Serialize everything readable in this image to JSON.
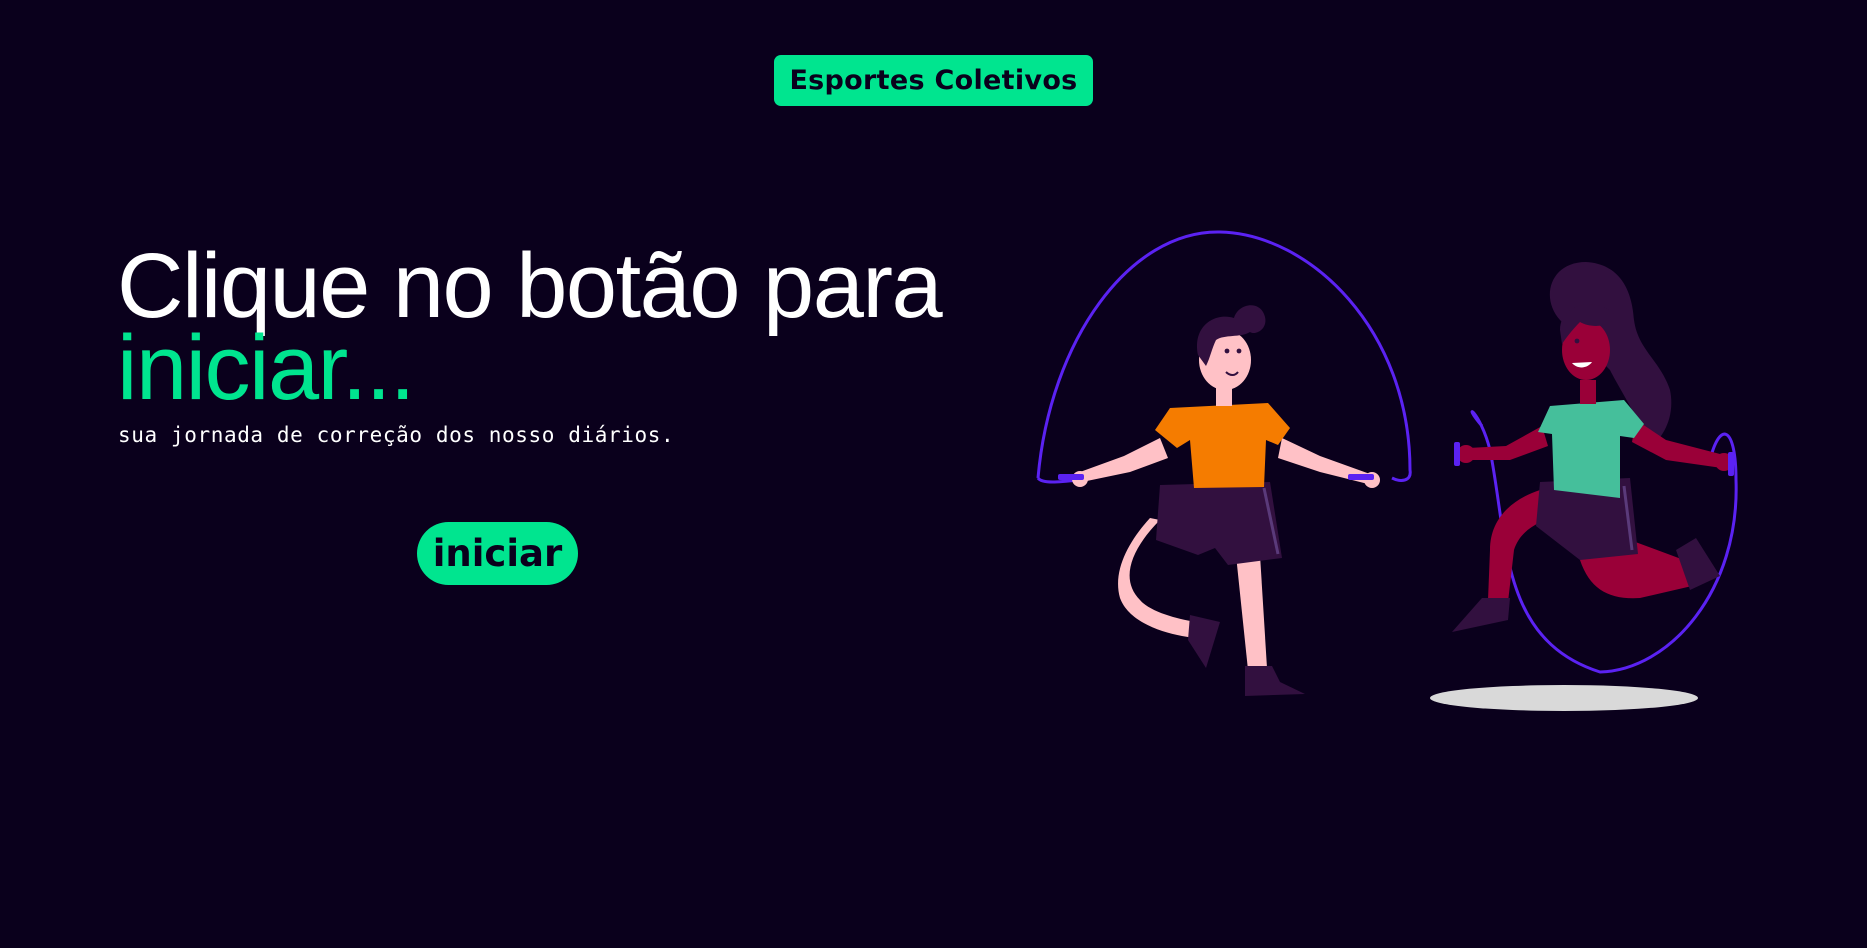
{
  "header": {
    "badge_label": "Esportes Coletivos"
  },
  "hero": {
    "title_line1": "Clique no botão para",
    "title_line2": "iniciar...",
    "subtitle": "sua jornada de correção dos nosso diários."
  },
  "actions": {
    "start_label": "iniciar"
  },
  "illustration": {
    "icon": "jump-rope-people-illustration"
  },
  "colors": {
    "background": "#0a001c",
    "accent": "#00e58f",
    "text": "#ffffff",
    "rope": "#5b22f2",
    "boy_shirt": "#f57c00",
    "girl_shirt": "#45bf9b",
    "girl_pants": "#9a0038"
  }
}
